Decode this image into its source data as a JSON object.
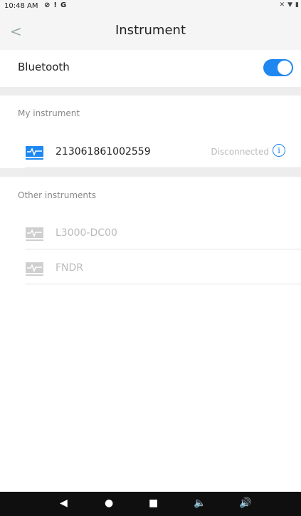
{
  "status_bar": {
    "time": "10:48 AM",
    "left_icons": [
      "shield-icon",
      "alert-icon",
      "google-icon"
    ],
    "right_icons": [
      "mute-icon",
      "wifi-icon",
      "battery-icon"
    ]
  },
  "app_bar": {
    "back_glyph": "<",
    "title": "Instrument"
  },
  "bluetooth": {
    "label": "Bluetooth",
    "enabled": true
  },
  "my_instrument": {
    "header": "My instrument",
    "items": [
      {
        "name": "213061861002559",
        "status": "Disconnected",
        "info_glyph": "i"
      }
    ]
  },
  "other_instruments": {
    "header": "Other instruments",
    "items": [
      {
        "name": "L3000-DC00"
      },
      {
        "name": "FNDR"
      }
    ]
  },
  "nav_bar": {
    "buttons": [
      "back-icon",
      "home-icon",
      "recents-icon",
      "volume-down-icon",
      "volume-up-icon"
    ]
  },
  "colors": {
    "accent": "#1e88f0",
    "divider": "#ededed",
    "app_bar_bg": "#f5f5f5",
    "nav_bar_bg": "#0f0f0f"
  }
}
